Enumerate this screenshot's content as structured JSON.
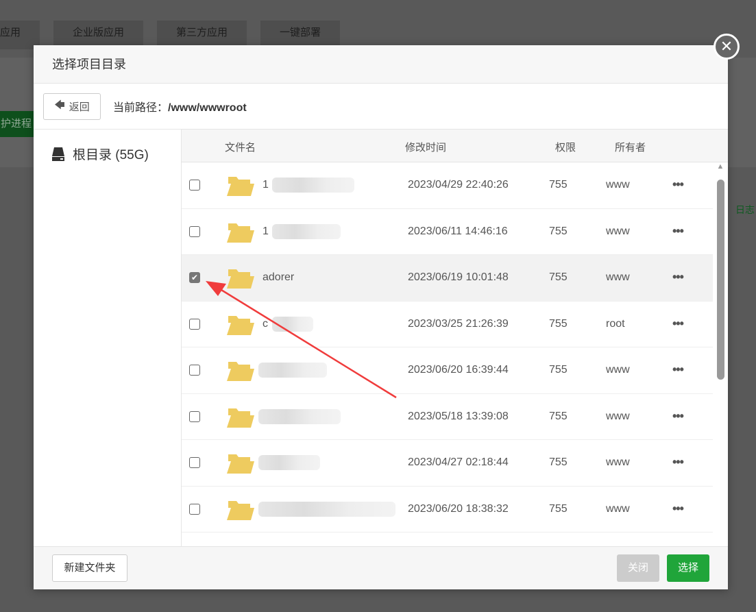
{
  "background": {
    "tabs": [
      "应用",
      "企业版应用",
      "第三方应用",
      "一键部署"
    ],
    "green_button": "护进程",
    "log_link": "日志"
  },
  "dialog": {
    "title": "选择项目目录",
    "back_label": "返回",
    "path_label": "当前路径：",
    "path_value": "/www/wwwroot",
    "root_label": "根目录 (55G)",
    "columns": {
      "name": "文件名",
      "time": "修改时间",
      "perm": "权限",
      "owner": "所有者"
    },
    "rows": [
      {
        "name": "1",
        "time": "2023/04/29 22:40:26",
        "perm": "755",
        "owner": "www",
        "checked": false
      },
      {
        "name": "1",
        "time": "2023/06/11 14:46:16",
        "perm": "755",
        "owner": "www",
        "checked": false
      },
      {
        "name": "adorer",
        "time": "2023/06/19 10:01:48",
        "perm": "755",
        "owner": "www",
        "checked": true
      },
      {
        "name": "c",
        "time": "2023/03/25 21:26:39",
        "perm": "755",
        "owner": "root",
        "checked": false
      },
      {
        "name": "",
        "time": "2023/06/20 16:39:44",
        "perm": "755",
        "owner": "www",
        "checked": false
      },
      {
        "name": "",
        "time": "2023/05/18 13:39:08",
        "perm": "755",
        "owner": "www",
        "checked": false
      },
      {
        "name": "",
        "time": "2023/04/27 02:18:44",
        "perm": "755",
        "owner": "www",
        "checked": false
      },
      {
        "name": "",
        "time": "2023/06/20 18:38:32",
        "perm": "755",
        "owner": "www",
        "checked": false
      }
    ],
    "new_folder_label": "新建文件夹",
    "close_label": "关闭",
    "select_label": "选择",
    "more_label": "•••"
  },
  "colors": {
    "accent": "#20a53a",
    "folder": "#eecb5f",
    "arrow": "#f03c3c"
  }
}
